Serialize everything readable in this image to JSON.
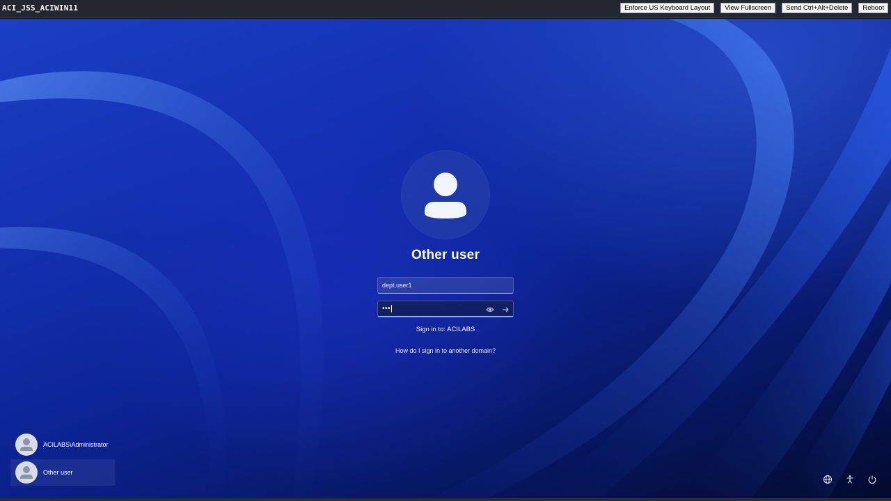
{
  "window": {
    "title": "ACI_JSS_ACIWIN11",
    "buttons": [
      "Enforce US Keyboard Layout",
      "View Fullscreen",
      "Send Ctrl+Alt+Delete",
      "Reboot"
    ]
  },
  "signin": {
    "user_display_name": "Other user",
    "username_value": "dept.user1",
    "password_masked": "•••",
    "sign_in_to": "Sign in to: ACILABS",
    "other_domain_link": "How do I sign in to another domain?",
    "icons": [
      "user-avatar-icon",
      "reveal-password-icon",
      "submit-arrow-icon"
    ]
  },
  "user_list": {
    "items": [
      {
        "label": "ACILABS\\Administrator",
        "selected": false
      },
      {
        "label": "Other user",
        "selected": true
      }
    ]
  },
  "system_icons": [
    "network-icon",
    "accessibility-icon",
    "power-icon"
  ],
  "colors": {
    "toolbar_bg": "#23262e",
    "wallpaper_primary": "#1330b0",
    "wallpaper_dark": "#020a2c",
    "password_focus": "#7fb3ff"
  }
}
